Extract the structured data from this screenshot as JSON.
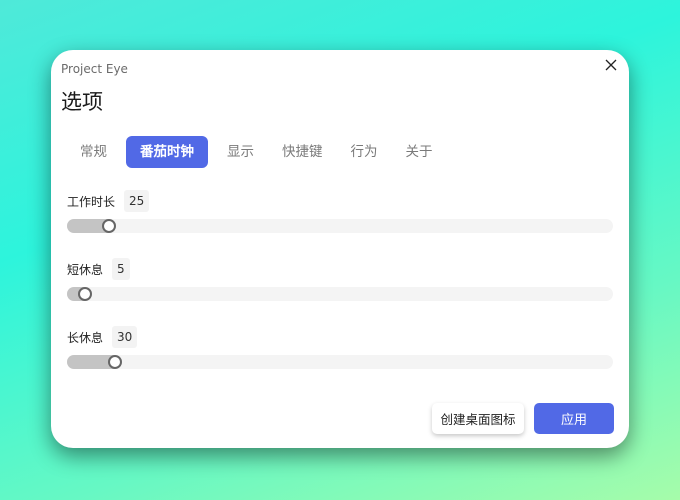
{
  "app": {
    "name": "Project Eye",
    "close_icon": "close-icon"
  },
  "page": {
    "title": "选项"
  },
  "tabs": [
    {
      "label": "常规",
      "active": false
    },
    {
      "label": "番茄时钟",
      "active": true
    },
    {
      "label": "显示",
      "active": false
    },
    {
      "label": "快捷键",
      "active": false
    },
    {
      "label": "行为",
      "active": false
    },
    {
      "label": "关于",
      "active": false
    }
  ],
  "settings": {
    "work_duration": {
      "label": "工作时长",
      "value": "25",
      "slider_fraction": 0.065
    },
    "short_break": {
      "label": "短休息",
      "value": "5",
      "slider_fraction": 0.02
    },
    "long_break": {
      "label": "长休息",
      "value": "30",
      "slider_fraction": 0.078
    }
  },
  "buttons": {
    "create_shortcut_label": "创建桌面图标",
    "apply_label": "应用"
  },
  "colors": {
    "accent": "#5169e6",
    "slider_fill": "#c4c4c4",
    "slider_track": "#f4f4f4"
  }
}
